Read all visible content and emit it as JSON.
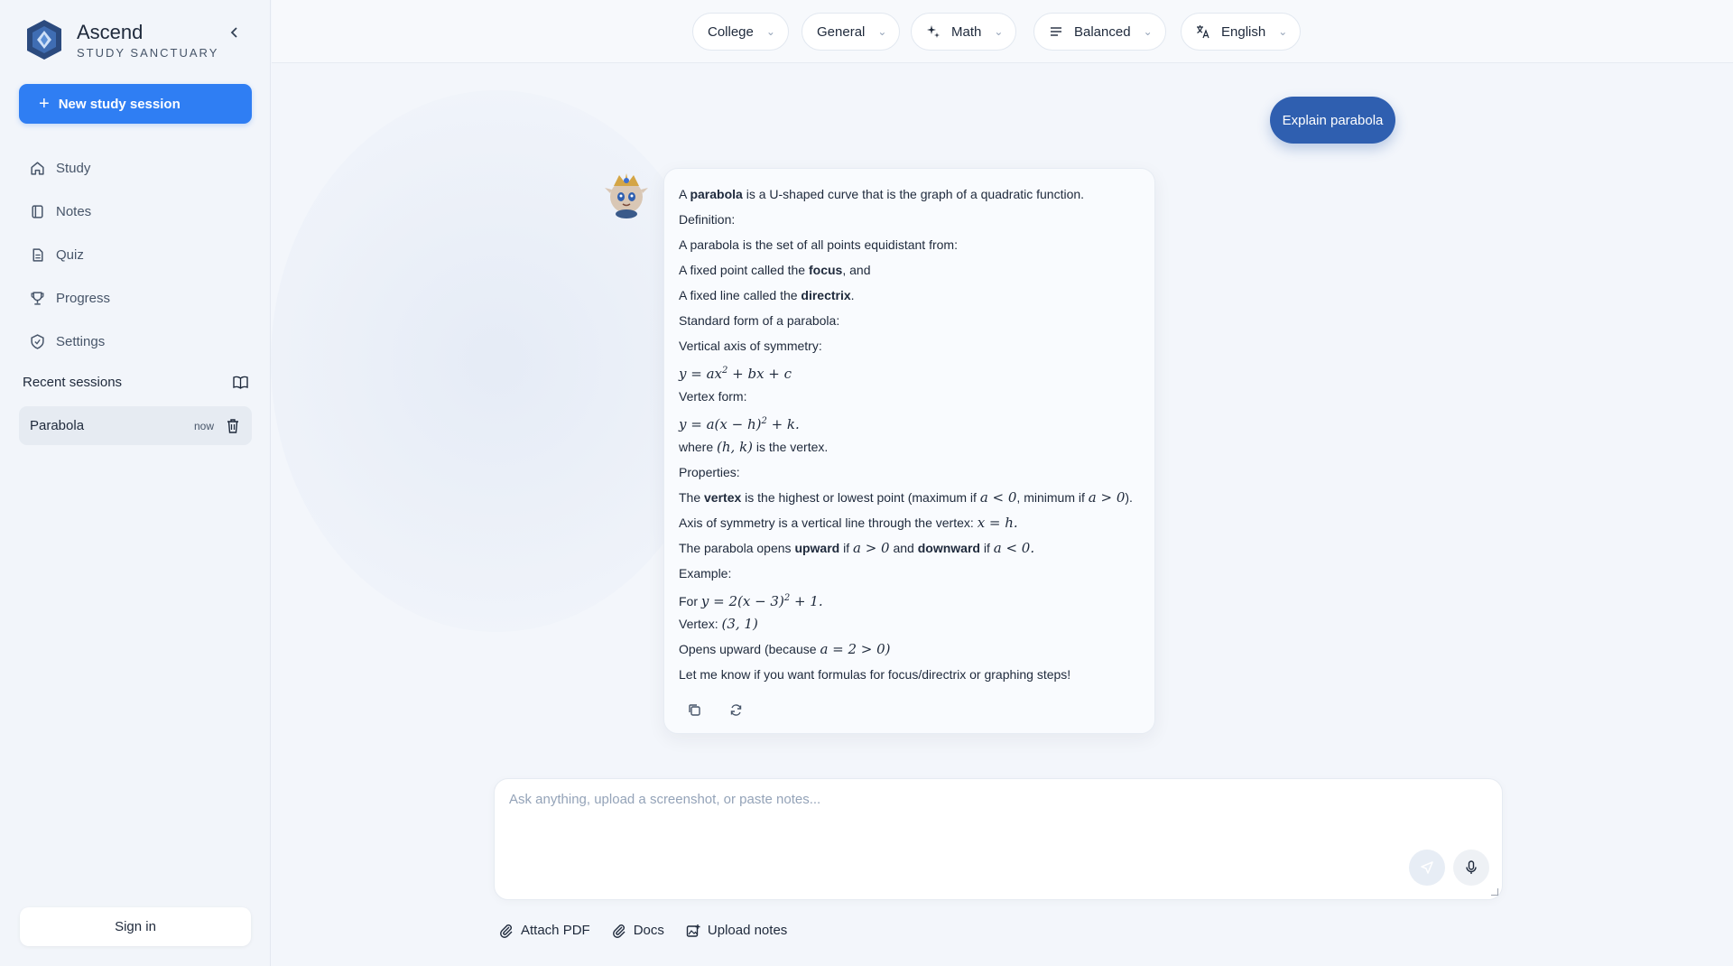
{
  "brand": {
    "name": "Ascend",
    "subtitle": "STUDY SANCTUARY"
  },
  "sidebar": {
    "new_session_label": "New study session",
    "nav": [
      {
        "label": "Study",
        "icon": "home-icon"
      },
      {
        "label": "Notes",
        "icon": "notebook-icon"
      },
      {
        "label": "Quiz",
        "icon": "document-icon"
      },
      {
        "label": "Progress",
        "icon": "trophy-icon"
      },
      {
        "label": "Settings",
        "icon": "badge-icon"
      }
    ],
    "recent_heading": "Recent sessions",
    "recent": [
      {
        "name": "Parabola",
        "time": "now"
      }
    ],
    "sign_in_label": "Sign in"
  },
  "topbar": {
    "level": "College",
    "mode": "General",
    "subject": "Math",
    "style": "Balanced",
    "language": "English"
  },
  "chat": {
    "user_message": "Explain parabola",
    "answer_lines": [
      "A <b>parabola</b> is a U-shaped curve that is the graph of a quadratic function.",
      "Definition:",
      "A parabola is the set of all points equidistant from:",
      "A fixed point called the <b>focus</b>, and",
      "A fixed line called the <b>directrix</b>.",
      "Standard form of a parabola:",
      "Vertical axis of symmetry:",
      "<span class=\"math\">y = ax<sup>2</sup> + bx + c</span>",
      "Vertex form:",
      "<span class=\"math\">y = a(x − h)<sup>2</sup> + k.</span>",
      "where <span class=\"math\">(h, k)</span> is the vertex.",
      "Properties:",
      "The <b>vertex</b> is the highest or lowest point (maximum if <span class=\"math\">a &lt; 0</span>, minimum if <span class=\"math\">a &gt; 0</span>).",
      "Axis of symmetry is a vertical line through the vertex: <span class=\"math\">x = h.</span>",
      "The parabola opens <b>upward</b> if <span class=\"math\">a &gt; 0</span> and <b>downward</b> if <span class=\"math\">a &lt; 0.</span>",
      "Example:",
      "For <span class=\"math\">y = 2(x − 3)<sup>2</sup> + 1.</span>",
      "Vertex: <span class=\"math\">(3, 1)</span>",
      "Opens upward (because <span class=\"math\">a = 2 &gt; 0)</span>",
      "Let me know if you want formulas for focus/directrix or graphing steps!"
    ]
  },
  "input": {
    "placeholder": "Ask anything, upload a screenshot, or paste notes...",
    "value": ""
  },
  "tools": {
    "attach_pdf": "Attach PDF",
    "docs": "Docs",
    "upload_notes": "Upload notes"
  },
  "colors": {
    "accent": "#2f7ef3",
    "user_bubble": "#2f5fb0"
  }
}
